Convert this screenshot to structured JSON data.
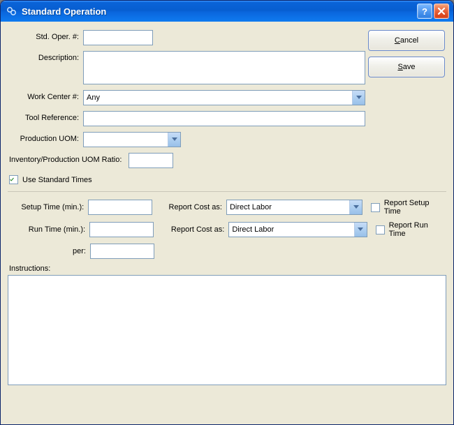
{
  "titlebar": {
    "title": "Standard Operation"
  },
  "buttons": {
    "cancel": "Cancel",
    "save": "Save"
  },
  "fields": {
    "std_oper_label": "Std. Oper. #:",
    "std_oper_value": "",
    "description_label": "Description:",
    "description_value": "",
    "work_center_label": "Work Center #:",
    "work_center_value": "Any",
    "tool_ref_label": "Tool Reference:",
    "tool_ref_value": "",
    "prod_uom_label": "Production UOM:",
    "prod_uom_value": "",
    "inv_ratio_label": "Inventory/Production UOM Ratio:",
    "inv_ratio_value": "",
    "use_std_times_label": "Use Standard Times",
    "use_std_times_checked": true,
    "setup_time_label": "Setup Time (min.):",
    "setup_time_value": "",
    "setup_report_cost_label": "Report Cost as:",
    "setup_report_cost_value": "Direct Labor",
    "report_setup_time_label": "Report Setup Time",
    "report_setup_time_checked": false,
    "run_time_label": "Run Time (min.):",
    "run_time_value": "",
    "run_report_cost_label": "Report Cost as:",
    "run_report_cost_value": "Direct Labor",
    "report_run_time_label": "Report Run Time",
    "report_run_time_checked": false,
    "per_label": "per:",
    "per_value": "",
    "instructions_label": "Instructions:",
    "instructions_value": ""
  }
}
